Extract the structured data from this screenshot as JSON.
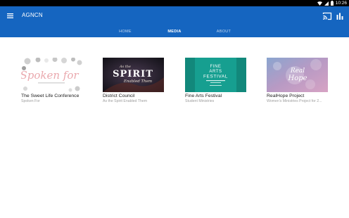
{
  "status_bar": {
    "time": "10:26"
  },
  "app_bar": {
    "title": "AGNCN",
    "brand_color": "#1565c0"
  },
  "tabs": [
    {
      "label": "HOME",
      "active": false
    },
    {
      "label": "MEDIA",
      "active": true
    },
    {
      "label": "ABOUT",
      "active": false
    }
  ],
  "media": [
    {
      "title": "The Sweet Life Conference",
      "subtitle": "Spoken For",
      "thumb": {
        "lines": [
          "Spoken for"
        ]
      }
    },
    {
      "title": "District Council",
      "subtitle": "As the Spirit Enabled Them",
      "thumb": {
        "lines": [
          "As the",
          "SPIRIT",
          "Enabled Them"
        ]
      }
    },
    {
      "title": "Fine Arts Festival",
      "subtitle": "Student Ministries",
      "thumb": {
        "lines": [
          "FINE",
          "ARTS",
          "FESTIVAL"
        ]
      }
    },
    {
      "title": "RealHope Project",
      "subtitle": "Women's Ministries Project for 2...",
      "thumb": {
        "lines": [
          "Real",
          "Hope"
        ]
      }
    }
  ]
}
